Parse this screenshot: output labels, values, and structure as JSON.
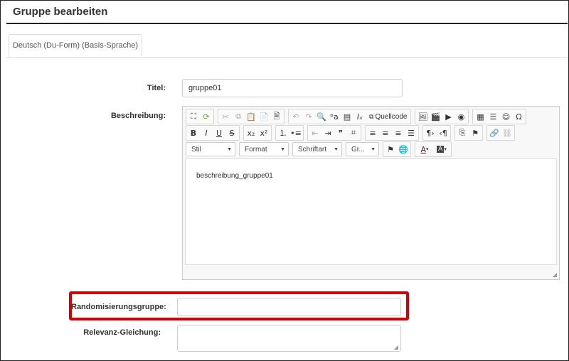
{
  "page": {
    "title": "Gruppe bearbeiten"
  },
  "tabs": [
    {
      "label": "Deutsch (Du-Form) (Basis-Sprache)",
      "active": true
    }
  ],
  "form": {
    "title_label": "Titel:",
    "title_value": "gruppe01",
    "description_label": "Beschreibung:",
    "description_value": "beschreibung_gruppe01",
    "randomization_label": "Randomisierungsgruppe:",
    "randomization_value": "",
    "relevance_label": "Relevanz-Gleichung:",
    "relevance_value": ""
  },
  "editor": {
    "source_label": "Quellcode",
    "combos": [
      {
        "label": "Stil"
      },
      {
        "label": "Format"
      },
      {
        "label": "Schriftart"
      },
      {
        "label": "Gr..."
      }
    ]
  },
  "colors": {
    "highlight": "#d40000",
    "title_rule": "#222222"
  }
}
